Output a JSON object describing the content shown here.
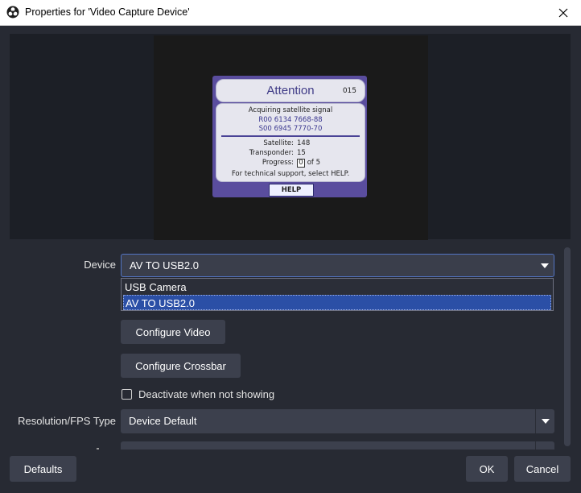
{
  "window": {
    "title": "Properties for 'Video Capture Device'",
    "app_icon": "obs-logo-icon",
    "close_icon": "close-icon"
  },
  "preview": {
    "tv": {
      "header_title": "Attention",
      "header_number": "015",
      "line1": "Acquiring satellite signal",
      "line2": "R00 6134 7668-88",
      "line3": "S00 6945 7770-70",
      "satellite_label": "Satellite:",
      "satellite_value": "148",
      "transponder_label": "Transponder:",
      "transponder_value": "15",
      "progress_label": "Progress:",
      "progress_current": "0",
      "progress_of": "of 5",
      "support": "For technical support, select HELP.",
      "help_button": "HELP"
    }
  },
  "form": {
    "device": {
      "label": "Device",
      "value": "AV TO USB2.0",
      "options": [
        "USB Camera",
        "AV TO USB2.0"
      ],
      "selected_index": 1
    },
    "configure_video_label": "Configure Video",
    "configure_crossbar_label": "Configure Crossbar",
    "deactivate_label": "Deactivate when not showing",
    "deactivate_checked": false,
    "resolution": {
      "label": "Resolution/FPS Type",
      "value": "Device Default"
    }
  },
  "footer": {
    "defaults_label": "Defaults",
    "ok_label": "OK",
    "cancel_label": "Cancel"
  },
  "colors": {
    "background": "#272a33",
    "control": "#3c404d",
    "accent": "#2b4fa6",
    "focus_border": "#5274c4"
  }
}
